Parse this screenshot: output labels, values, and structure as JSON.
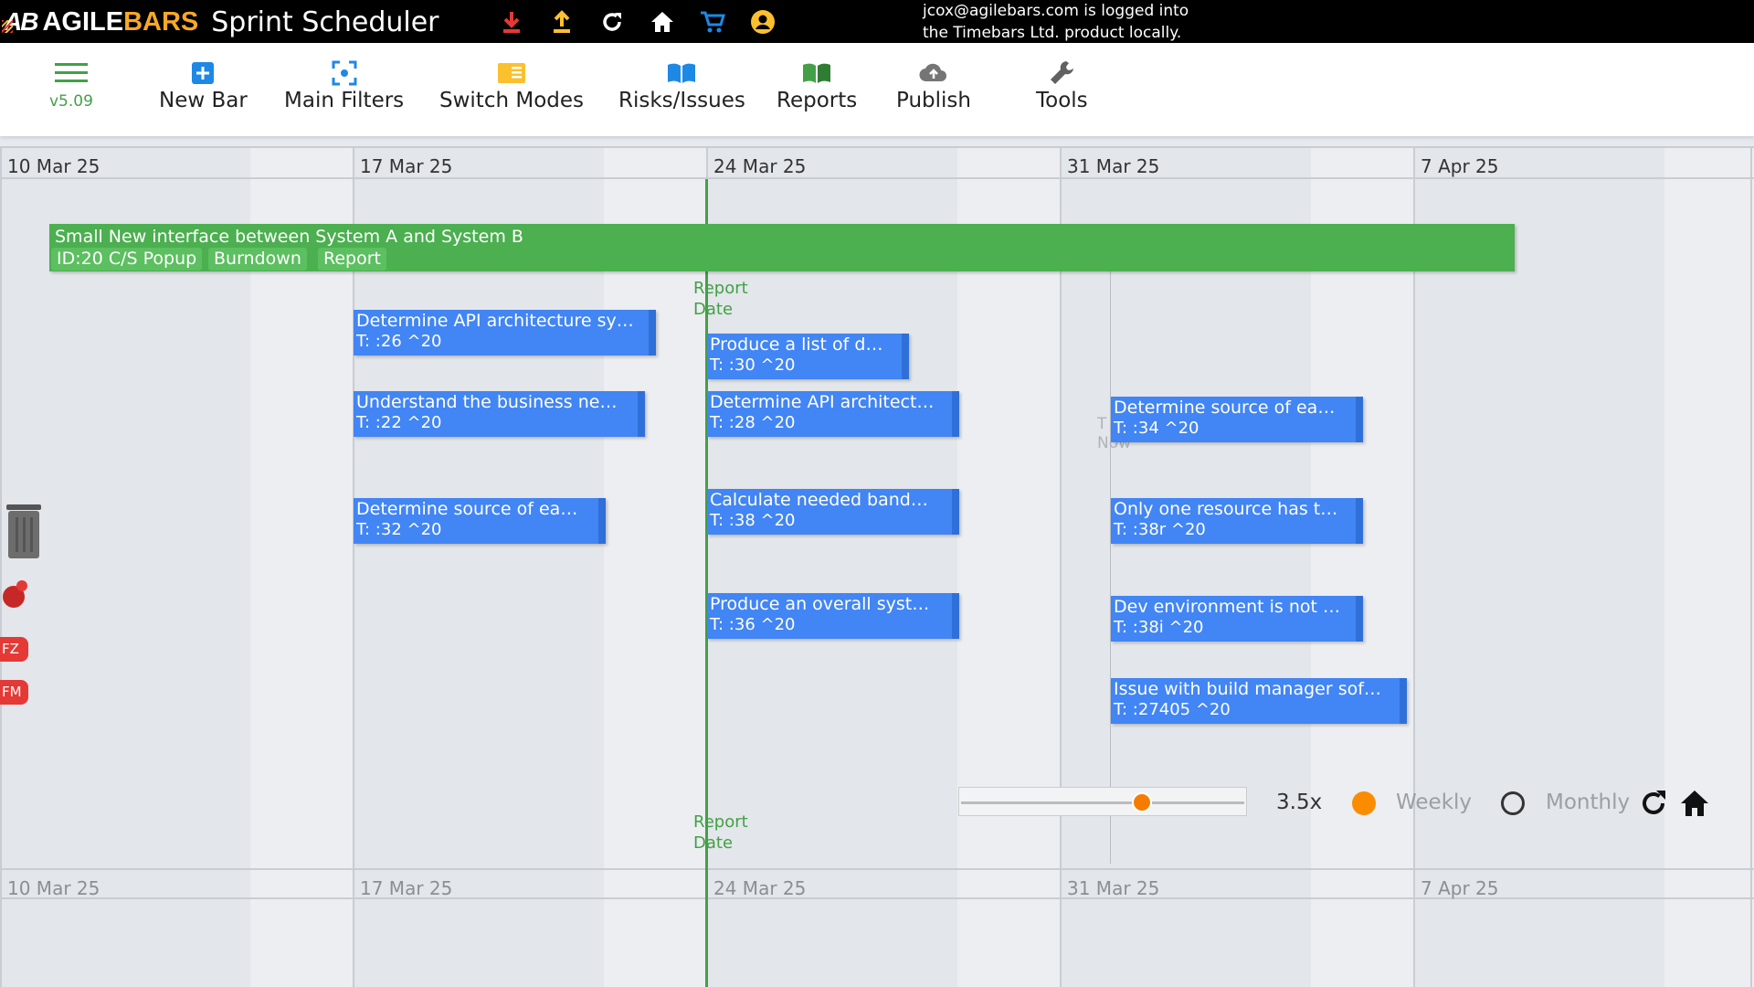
{
  "header": {
    "logo_mark": "AB",
    "logo_agile": "AGILE",
    "logo_bars": "BARS",
    "title": "Sprint Scheduler",
    "login_line1": "jcox@agilebars.com is logged into",
    "login_line2": "the Timebars Ltd. product locally.",
    "icons": [
      "download-icon",
      "upload-icon",
      "refresh-icon",
      "home-icon",
      "cart-icon",
      "user-icon"
    ]
  },
  "toolbar": {
    "version": "v5.09",
    "items": [
      {
        "label": "New Bar",
        "icon": "plus-square-icon"
      },
      {
        "label": "Main Filters",
        "icon": "focus-icon"
      },
      {
        "label": "Switch Modes",
        "icon": "modes-icon"
      },
      {
        "label": "Risks/Issues",
        "icon": "book-blue-icon"
      },
      {
        "label": "Reports",
        "icon": "book-green-icon"
      },
      {
        "label": "Publish",
        "icon": "cloud-upload-icon"
      },
      {
        "label": "Tools",
        "icon": "wrench-icon"
      }
    ]
  },
  "timeline": {
    "weeks": [
      "10 Mar 25",
      "17 Mar 25",
      "24 Mar 25",
      "31 Mar 25",
      "7 Apr 25"
    ],
    "report_date_label_1": "Report",
    "report_date_label_2": "Date",
    "now_label_1": "T",
    "now_label_2": "Now"
  },
  "sprint": {
    "title": "Small New interface between System A and System B",
    "chips": [
      "ID:20 C/S Popup",
      "Burndown",
      "Report"
    ]
  },
  "tasks": [
    {
      "title": "Determine API architecture sy…",
      "meta": "T: :26 ^20"
    },
    {
      "title": "Understand the business ne…",
      "meta": "T: :22 ^20"
    },
    {
      "title": "Determine source of ea…",
      "meta": "T: :32 ^20"
    },
    {
      "title": "Produce a list of d…",
      "meta": "T: :30 ^20"
    },
    {
      "title": "Determine API architect…",
      "meta": "T: :28 ^20"
    },
    {
      "title": "Calculate needed band…",
      "meta": "T: :38 ^20"
    },
    {
      "title": "Produce an overall syst…",
      "meta": "T: :36 ^20"
    },
    {
      "title": "Determine source of ea…",
      "meta": "T: :34 ^20"
    },
    {
      "title": "Only one resource has t…",
      "meta": "T: :38r ^20"
    },
    {
      "title": "Dev environment is not …",
      "meta": "T: :38i ^20"
    },
    {
      "title": "Issue with build manager sof…",
      "meta": "T: :27405 ^20"
    }
  ],
  "side": {
    "tags": [
      "FZ",
      "FM"
    ]
  },
  "controls": {
    "zoom": "3.5x",
    "zoom_level_fraction": 0.65,
    "weekly": "Weekly",
    "monthly": "Monthly",
    "selected_mode": "Weekly"
  },
  "colors": {
    "sprint_bar": "#4caf50",
    "task_bar": "#4285f4",
    "report_line": "#43a047",
    "accent_orange": "#fb8c00",
    "logo_bars": "#f9a825"
  }
}
